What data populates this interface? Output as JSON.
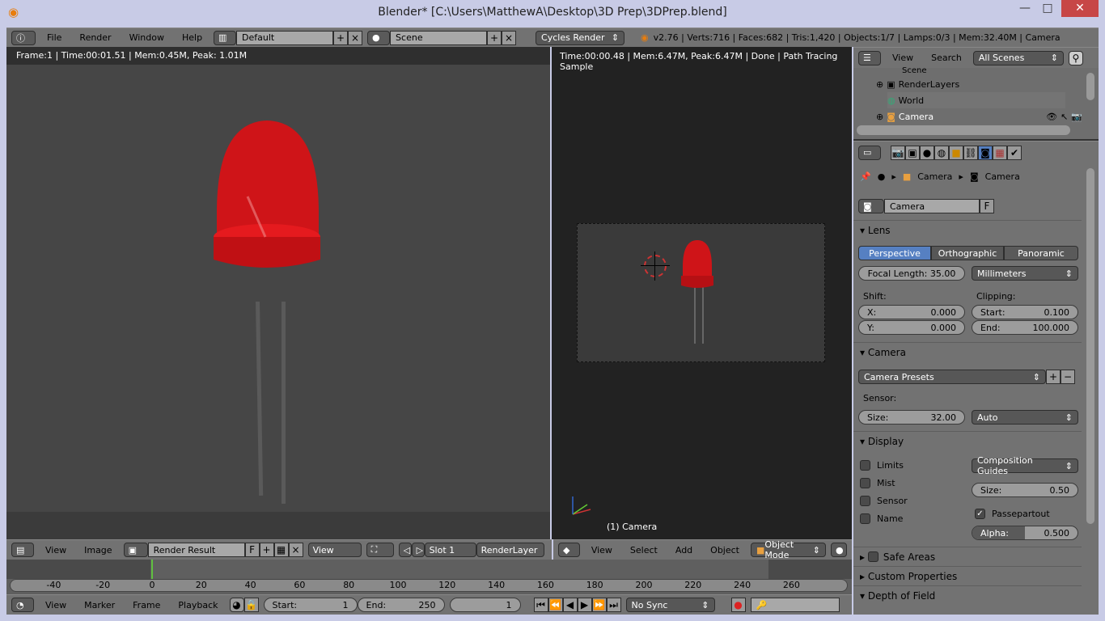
{
  "window": {
    "title": "Blender* [C:\\Users\\MatthewA\\Desktop\\3D Prep\\3DPrep.blend]",
    "minimize": "—",
    "maximize": "□",
    "close": "✕"
  },
  "top_header": {
    "menus": [
      "File",
      "Render",
      "Window",
      "Help"
    ],
    "layout": "Default",
    "scene": "Scene",
    "engine": "Cycles Render",
    "stats": "v2.76 | Verts:716 | Faces:682 | Tris:1,420 | Objects:1/7 | Lamps:0/3 | Mem:32.40M | Camera"
  },
  "image_editor": {
    "info": "Frame:1 | Time:00:01.51 | Mem:0.45M, Peak: 1.01M",
    "menus": [
      "View",
      "Image"
    ],
    "image": "Render Result",
    "fake_user": "F",
    "view": "View",
    "slot": "Slot 1",
    "layer": "RenderLayer"
  },
  "viewport": {
    "info": "Time:00:00.48 | Mem:6.47M, Peak:6.47M | Done | Path Tracing Sample",
    "object_label": "(1) Camera",
    "menus": [
      "View",
      "Select",
      "Add",
      "Object"
    ],
    "mode": "Object Mode"
  },
  "timeline": {
    "ticks": [
      "-40",
      "-20",
      "0",
      "20",
      "40",
      "60",
      "80",
      "100",
      "120",
      "140",
      "160",
      "180",
      "200",
      "220",
      "240",
      "260"
    ],
    "menus": [
      "View",
      "Marker",
      "Frame",
      "Playback"
    ],
    "start_label": "Start:",
    "start": "1",
    "end_label": "End:",
    "end": "250",
    "current": "1",
    "sync": "No Sync"
  },
  "outliner": {
    "menus": [
      "View",
      "Search"
    ],
    "filter": "All Scenes",
    "items": [
      "Scene",
      "RenderLayers",
      "World",
      "Camera"
    ]
  },
  "properties": {
    "breadcrumb": [
      "Camera",
      "Camera"
    ],
    "datablock": "Camera",
    "fake_user": "F",
    "lens": {
      "title": "Lens",
      "tabs": [
        "Perspective",
        "Orthographic",
        "Panoramic"
      ],
      "active_tab": "Perspective",
      "focal": "Focal Length: 35.00",
      "unit": "Millimeters",
      "shift_label": "Shift:",
      "clip_label": "Clipping:",
      "shift_x_label": "X:",
      "shift_x": "0.000",
      "shift_y_label": "Y:",
      "shift_y": "0.000",
      "clip_start_label": "Start:",
      "clip_start": "0.100",
      "clip_end_label": "End:",
      "clip_end": "100.000"
    },
    "camera": {
      "title": "Camera",
      "presets": "Camera Presets",
      "sensor_label": "Sensor:",
      "size_label": "Size:",
      "size": "32.00",
      "fit": "Auto"
    },
    "display": {
      "title": "Display",
      "checks": [
        {
          "label": "Limits",
          "checked": false
        },
        {
          "label": "Mist",
          "checked": false
        },
        {
          "label": "Sensor",
          "checked": false
        },
        {
          "label": "Name",
          "checked": false
        }
      ],
      "guides": "Composition Guides",
      "size_label": "Size:",
      "size": "0.50",
      "passepartout": "Passepartout",
      "passepartout_checked": true,
      "alpha_label": "Alpha:",
      "alpha": "0.500"
    },
    "collapsed": [
      "Safe Areas",
      "Custom Properties",
      "Depth of Field"
    ]
  },
  "colors": {
    "accent": "#5680c2",
    "led": "#d4141a",
    "playhead": "#60c040"
  }
}
